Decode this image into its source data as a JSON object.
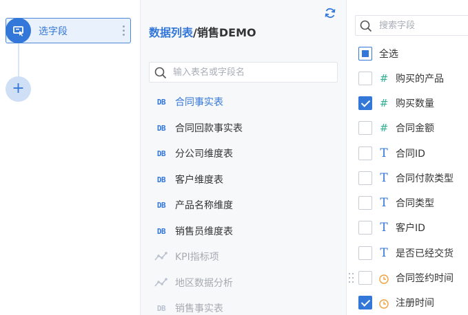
{
  "steps": {
    "current_label": "选字段",
    "add_symbol": "+"
  },
  "tables_panel": {
    "breadcrumb_root": "数据列表",
    "breadcrumb_separator": "/",
    "breadcrumb_current": "销售DEMO",
    "search_placeholder": "输入表名或字段名",
    "items": [
      {
        "label": "合同事实表",
        "type": "db",
        "state": "active"
      },
      {
        "label": "合同回款事实表",
        "type": "db",
        "state": "normal"
      },
      {
        "label": "分公司维度表",
        "type": "db",
        "state": "normal"
      },
      {
        "label": "客户维度表",
        "type": "db",
        "state": "normal"
      },
      {
        "label": "产品名称维度",
        "type": "db",
        "state": "normal"
      },
      {
        "label": "销售员维度表",
        "type": "db",
        "state": "normal"
      },
      {
        "label": "KPI指标项",
        "type": "analysis",
        "state": "disabled"
      },
      {
        "label": "地区数据分析",
        "type": "analysis",
        "state": "disabled"
      },
      {
        "label": "销售事实表",
        "type": "db",
        "state": "disabled"
      }
    ],
    "db_badge": "DB"
  },
  "fields_panel": {
    "search_placeholder": "搜索字段",
    "select_all_label": "全选",
    "fields": [
      {
        "label": "购买的产品",
        "type": "number",
        "checked": false
      },
      {
        "label": "购买数量",
        "type": "number",
        "checked": true
      },
      {
        "label": "合同金额",
        "type": "number",
        "checked": false
      },
      {
        "label": "合同ID",
        "type": "text",
        "checked": false
      },
      {
        "label": "合同付款类型",
        "type": "text",
        "checked": false
      },
      {
        "label": "合同类型",
        "type": "text",
        "checked": false
      },
      {
        "label": "客户ID",
        "type": "text",
        "checked": false
      },
      {
        "label": "是否已经交货",
        "type": "text",
        "checked": false
      },
      {
        "label": "合同签约时间",
        "type": "time",
        "checked": false
      },
      {
        "label": "注册时间",
        "type": "time",
        "checked": true
      }
    ],
    "number_symbol": "#",
    "text_symbol": "T"
  },
  "colors": {
    "accent": "#3377d8",
    "number_type": "#2eb091",
    "time_type": "#f0a038"
  }
}
